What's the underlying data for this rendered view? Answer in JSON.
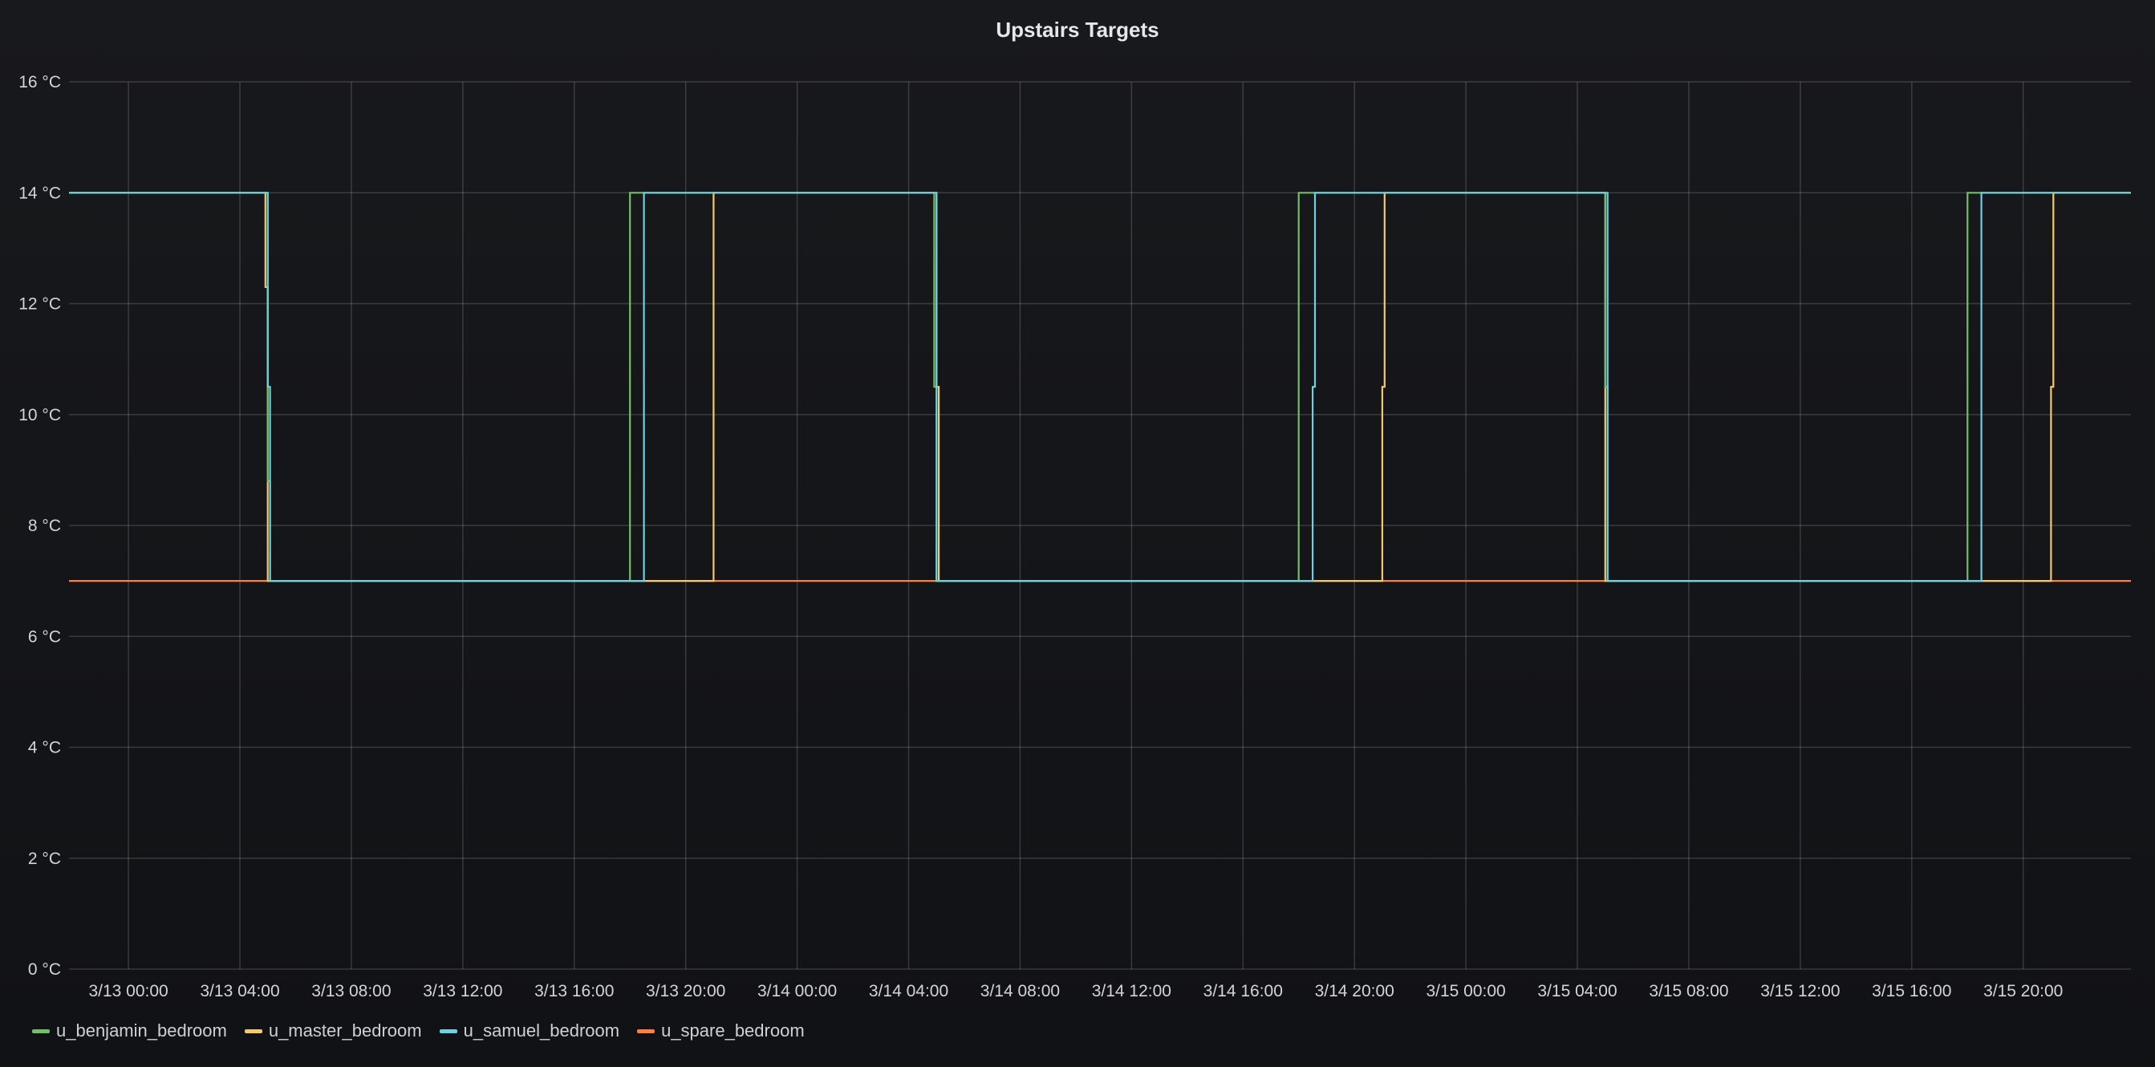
{
  "chart_data": {
    "type": "line",
    "title": "Upstairs Targets",
    "ylabel": "",
    "xlabel": "",
    "ylim": [
      0,
      16
    ],
    "xlim": [
      "3/12 21:52",
      "3/15 23:52"
    ],
    "y_ticks": [
      "0 °C",
      "2 °C",
      "4 °C",
      "6 °C",
      "8 °C",
      "10 °C",
      "12 °C",
      "14 °C",
      "16 °C"
    ],
    "y_tick_values": [
      0,
      2,
      4,
      6,
      8,
      10,
      12,
      14,
      16
    ],
    "x_ticks": [
      "3/13 00:00",
      "3/13 04:00",
      "3/13 08:00",
      "3/13 12:00",
      "3/13 16:00",
      "3/13 20:00",
      "3/14 00:00",
      "3/14 04:00",
      "3/14 08:00",
      "3/14 12:00",
      "3/14 16:00",
      "3/14 20:00",
      "3/15 00:00",
      "3/15 04:00",
      "3/15 08:00",
      "3/15 12:00",
      "3/15 16:00",
      "3/15 20:00"
    ],
    "x_tick_values": [
      "3/13 00:00",
      "3/13 04:00",
      "3/13 08:00",
      "3/13 12:00",
      "3/13 16:00",
      "3/13 20:00",
      "3/14 00:00",
      "3/14 04:00",
      "3/14 08:00",
      "3/14 12:00",
      "3/14 16:00",
      "3/14 20:00",
      "3/15 00:00",
      "3/15 04:00",
      "3/15 08:00",
      "3/15 12:00",
      "3/15 16:00",
      "3/15 20:00"
    ],
    "grid": true,
    "legend": "bottom-left",
    "series": [
      {
        "name": "u_benjamin_bedroom",
        "color": "#73bf69",
        "x": [
          "3/12 21:52",
          "3/13 05:00",
          "3/13 05:00",
          "3/13 05:05",
          "3/13 05:05",
          "3/13 18:00",
          "3/13 18:00",
          "3/14 04:55",
          "3/14 04:55",
          "3/14 05:00",
          "3/14 05:00",
          "3/14 18:00",
          "3/14 18:00",
          "3/15 05:00",
          "3/15 05:00",
          "3/15 05:05",
          "3/15 05:05",
          "3/15 18:00",
          "3/15 18:00",
          "3/15 23:52"
        ],
        "y": [
          14,
          14,
          8.8,
          8.8,
          7,
          7,
          14,
          14,
          10.5,
          10.5,
          7,
          7,
          14,
          14,
          10.5,
          10.5,
          7,
          7,
          14,
          14
        ]
      },
      {
        "name": "u_master_bedroom",
        "color": "#f2c96d",
        "x": [
          "3/12 21:52",
          "3/13 04:55",
          "3/13 04:55",
          "3/13 05:00",
          "3/13 05:00",
          "3/13 21:00",
          "3/13 21:00",
          "3/14 05:00",
          "3/14 05:00",
          "3/14 05:05",
          "3/14 05:05",
          "3/14 21:00",
          "3/14 21:00",
          "3/14 21:05",
          "3/14 21:05",
          "3/15 05:00",
          "3/15 05:00",
          "3/15 21:00",
          "3/15 21:00",
          "3/15 21:05",
          "3/15 21:05",
          "3/15 23:52"
        ],
        "y": [
          14,
          14,
          12.3,
          12.3,
          7,
          7,
          14,
          14,
          10.5,
          10.5,
          7,
          7,
          10.5,
          10.5,
          14,
          14,
          7,
          7,
          10.5,
          10.5,
          14,
          14
        ]
      },
      {
        "name": "u_samuel_bedroom",
        "color": "#6ed0e0",
        "x": [
          "3/12 21:52",
          "3/13 05:00",
          "3/13 05:00",
          "3/13 05:05",
          "3/13 05:05",
          "3/13 18:30",
          "3/13 18:30",
          "3/14 05:00",
          "3/14 05:00",
          "3/14 18:30",
          "3/14 18:30",
          "3/14 18:35",
          "3/14 18:35",
          "3/15 05:05",
          "3/15 05:05",
          "3/15 18:30",
          "3/15 18:30",
          "3/15 23:52"
        ],
        "y": [
          14,
          14,
          10.5,
          10.5,
          7,
          7,
          14,
          14,
          7,
          7,
          10.5,
          10.5,
          14,
          14,
          7,
          7,
          14,
          14
        ]
      },
      {
        "name": "u_spare_bedroom",
        "color": "#ff7f3f",
        "x": [
          "3/12 21:52",
          "3/15 23:52"
        ],
        "y": [
          7,
          7
        ]
      }
    ]
  }
}
